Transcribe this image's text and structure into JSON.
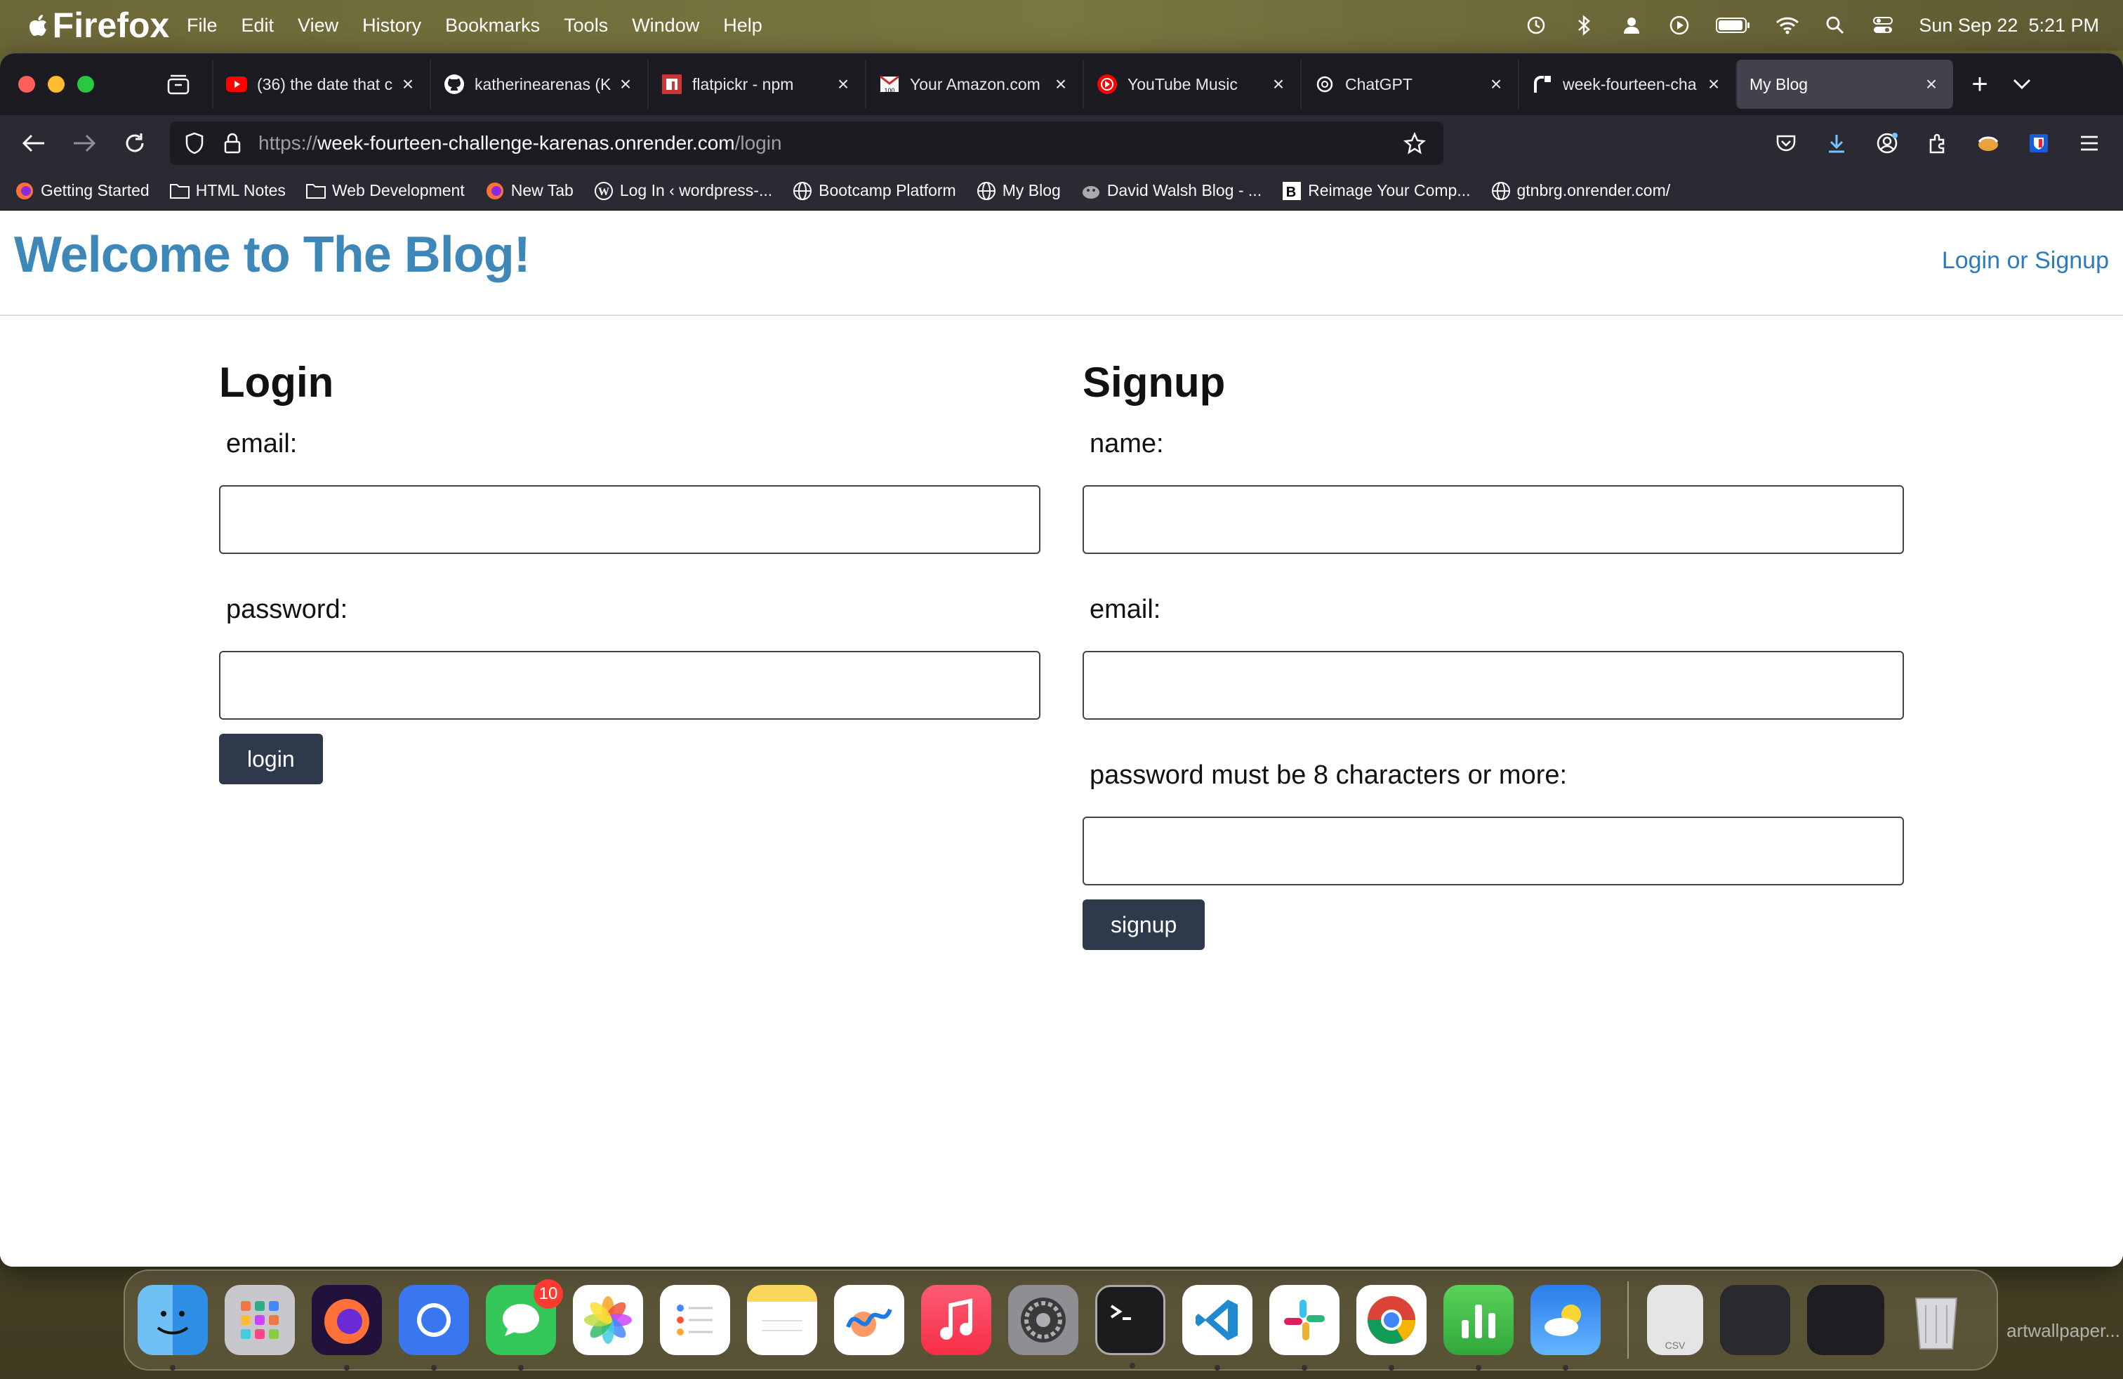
{
  "menubar": {
    "app_name": "Firefox",
    "menus": [
      "File",
      "Edit",
      "View",
      "History",
      "Bookmarks",
      "Tools",
      "Window",
      "Help"
    ],
    "clock": "Sun Sep 22  5:21 PM"
  },
  "tabs": [
    {
      "title": "(36) the date that c",
      "icon": "youtube-icon"
    },
    {
      "title": "katherinearenas (K",
      "icon": "github-icon"
    },
    {
      "title": "flatpickr - npm",
      "icon": "npm-icon"
    },
    {
      "title": "Your Amazon.com",
      "icon": "amazon-icon"
    },
    {
      "title": "YouTube Music",
      "icon": "youtube-music-icon"
    },
    {
      "title": "ChatGPT",
      "icon": "chatgpt-icon"
    },
    {
      "title": "week-fourteen-cha",
      "icon": "render-icon"
    },
    {
      "title": "My Blog",
      "icon": "none",
      "active": true
    }
  ],
  "urlbar": {
    "protocol": "https://",
    "host": "week-fourteen-challenge-karenas.onrender.com",
    "path": "/login"
  },
  "bookmarks": [
    {
      "label": "Getting Started",
      "icon": "firefox-icon"
    },
    {
      "label": "HTML Notes",
      "icon": "folder-icon"
    },
    {
      "label": "Web Development",
      "icon": "folder-icon"
    },
    {
      "label": "New Tab",
      "icon": "firefox-icon"
    },
    {
      "label": "Log In ‹ wordpress-...",
      "icon": "wordpress-icon"
    },
    {
      "label": "Bootcamp Platform",
      "icon": "globe-icon"
    },
    {
      "label": "My Blog",
      "icon": "globe-icon"
    },
    {
      "label": "David Walsh Blog - ...",
      "icon": "davidwalsh-icon"
    },
    {
      "label": "Reimage Your Comp...",
      "icon": "b-icon"
    },
    {
      "label": "gtnbrg.onrender.com/",
      "icon": "globe-icon"
    }
  ],
  "page": {
    "site_title": "Welcome to The Blog!",
    "nav_link": "Login or Signup",
    "login": {
      "heading": "Login",
      "email_label": "email:",
      "password_label": "password:",
      "button": "login"
    },
    "signup": {
      "heading": "Signup",
      "name_label": "name:",
      "email_label": "email:",
      "password_label": "password must be 8 characters or more:",
      "button": "signup"
    }
  },
  "dock": {
    "apps": [
      "Finder",
      "Launchpad",
      "Firefox",
      "Signal",
      "Messages",
      "Photos",
      "Reminders",
      "Notes",
      "Freeform",
      "Music",
      "System Settings",
      "Terminal",
      "Visual Studio Code",
      "Slack",
      "Google Chrome",
      "Numbers",
      "Weather"
    ],
    "messages_badge": "10",
    "csv_label": "CSV"
  },
  "watermark": "artwallpaper...",
  "colors": {
    "accent": "#3d88b8",
    "link": "#2c7bbf",
    "button": "#2e3a4c"
  }
}
